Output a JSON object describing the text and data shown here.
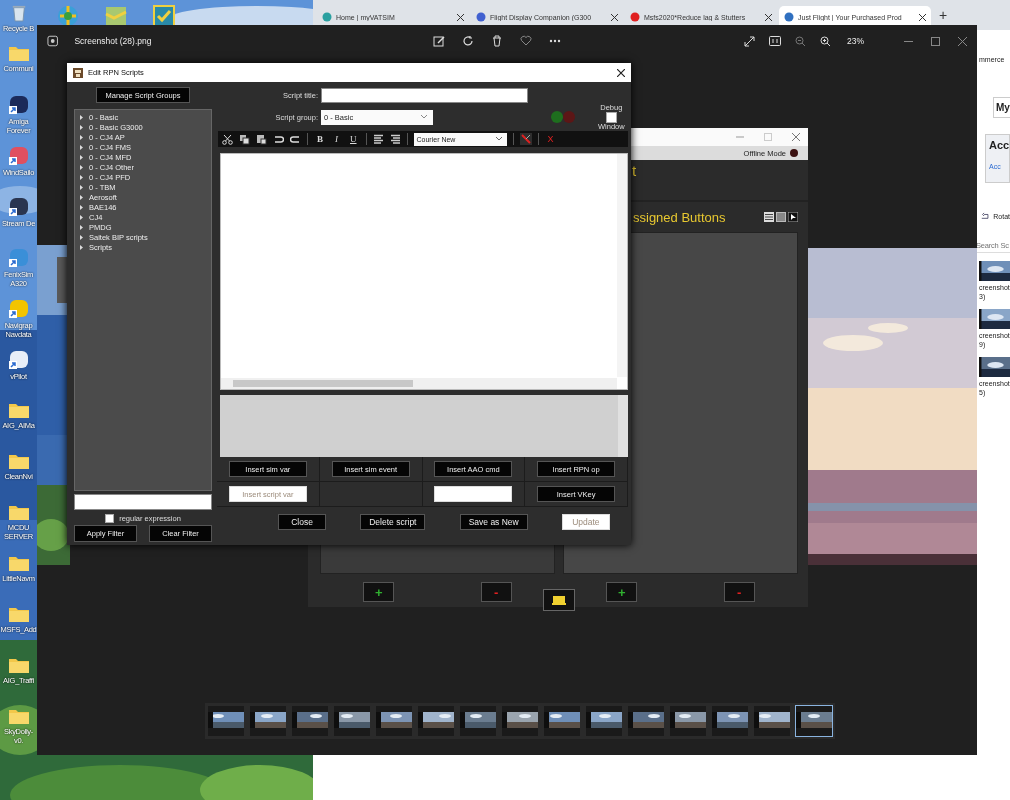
{
  "desktop": {
    "icons": [
      {
        "label": "Recycle B",
        "kind": "bin"
      },
      {
        "label": "Communi",
        "kind": "folder"
      },
      {
        "label": "Amiga Forever",
        "kind": "app"
      },
      {
        "label": "WindSailo",
        "kind": "app"
      },
      {
        "label": "Stream De",
        "kind": "app"
      },
      {
        "label": "FenixSim A320",
        "kind": "app"
      },
      {
        "label": "Navigrap Navdata",
        "kind": "app"
      },
      {
        "label": "vPilot",
        "kind": "app"
      },
      {
        "label": "AIG_AIMa",
        "kind": "folder"
      },
      {
        "label": "CleanNvi",
        "kind": "folder"
      },
      {
        "label": "MCDU SERVER",
        "kind": "folder"
      },
      {
        "label": "LittleNavm",
        "kind": "folder"
      },
      {
        "label": "MSFS_Add",
        "kind": "folder"
      },
      {
        "label": "AIG_Traffi",
        "kind": "folder"
      },
      {
        "label": "SkyDolly-v0.",
        "kind": "folder"
      }
    ]
  },
  "browser": {
    "tabs": [
      {
        "label": "Home | myVATSIM",
        "selected": false
      },
      {
        "label": "Flight Display Companion (G300",
        "selected": false
      },
      {
        "label": "Msfs2020*Reduce lag & Stutters",
        "selected": false
      },
      {
        "label": "Just Flight | Your Purchased Prod",
        "selected": true
      }
    ],
    "new_tab": "+",
    "page": {
      "header_fragment": "mmerce",
      "menu": "My",
      "card_title": "Acc",
      "card_link": "Acc",
      "rotate": "Rotat",
      "search_placeholder": "Search Sc",
      "files": [
        {
          "name": "creenshot 3)"
        },
        {
          "name": "creenshot 9)"
        },
        {
          "name": "creenshot 5)"
        }
      ]
    }
  },
  "photo_viewer": {
    "title": "Screenshot (28).png",
    "zoom": "23%",
    "filmstrip": [
      {
        "selected": false
      },
      {
        "selected": false
      },
      {
        "selected": false
      },
      {
        "selected": false
      },
      {
        "selected": false
      },
      {
        "selected": false
      },
      {
        "selected": false
      },
      {
        "selected": false
      },
      {
        "selected": false
      },
      {
        "selected": false
      },
      {
        "selected": false
      },
      {
        "selected": false
      },
      {
        "selected": false
      },
      {
        "selected": false
      },
      {
        "selected": true
      }
    ]
  },
  "aao_window": {
    "status": "Offline Mode",
    "title_fragment": "t",
    "panel_title": "ssigned Buttons",
    "buttons": [
      {
        "label": "+",
        "kind": "add"
      },
      {
        "label": "-",
        "kind": "remove"
      }
    ]
  },
  "rpn_dialog": {
    "title": "Edit RPN Scripts",
    "manage_button": "Manage Script Groups",
    "groups": [
      {
        "label": "0 - Basic",
        "expanded": false
      },
      {
        "label": "0 - Basic G3000",
        "expanded": false
      },
      {
        "label": "0 - CJ4 AP",
        "expanded": false
      },
      {
        "label": "0 - CJ4 FMS",
        "expanded": false
      },
      {
        "label": "0 - CJ4 MFD",
        "expanded": false
      },
      {
        "label": "0 - CJ4 Other",
        "expanded": false
      },
      {
        "label": "0 - CJ4 PFD",
        "expanded": false
      },
      {
        "label": "0 - TBM",
        "expanded": false
      },
      {
        "label": "Aerosoft",
        "expanded": false
      },
      {
        "label": "BAE146",
        "expanded": false
      },
      {
        "label": "CJ4",
        "expanded": false
      },
      {
        "label": "PMDG",
        "expanded": false
      },
      {
        "label": "Saitek BIP scripts",
        "expanded": false
      },
      {
        "label": "Scripts",
        "expanded": false
      }
    ],
    "regex_label": "regular expression",
    "regex_checked": false,
    "apply_filter": "Apply Filter",
    "clear_filter": "Clear Filter",
    "script_title_label": "Script title:",
    "script_group_label": "Script group:",
    "script_group_value": "0 - Basic",
    "lights": [
      {
        "color": "#1e6e1e"
      },
      {
        "color": "#5c1616"
      }
    ],
    "debug": {
      "top": "Debug",
      "bottom": "Window",
      "checked": false
    },
    "toolbar": {
      "bold": "B",
      "italic": "I",
      "underline": "U",
      "font": "Courier New",
      "clear": "X"
    },
    "insert_rows": [
      [
        {
          "kind": "button",
          "label": "Insert sim var",
          "disabled": false
        },
        {
          "kind": "button",
          "label": "Insert sim event",
          "disabled": false
        },
        {
          "kind": "button",
          "label": "Insert AAO cmd",
          "disabled": false
        },
        {
          "kind": "button",
          "label": "Insert RPN op",
          "disabled": false
        }
      ],
      [
        {
          "kind": "button",
          "label": "Insert script var",
          "disabled": true
        },
        {
          "kind": "empty"
        },
        {
          "kind": "button",
          "disabled": true
        },
        {
          "kind": "button",
          "label": "Insert VKey",
          "disabled": false
        }
      ]
    ],
    "actions": [
      {
        "label": "Close",
        "disabled": false
      },
      {
        "label": "Delete script",
        "disabled": false
      },
      {
        "label": "Save as New",
        "disabled": false
      },
      {
        "label": "Update",
        "disabled": true
      }
    ]
  }
}
